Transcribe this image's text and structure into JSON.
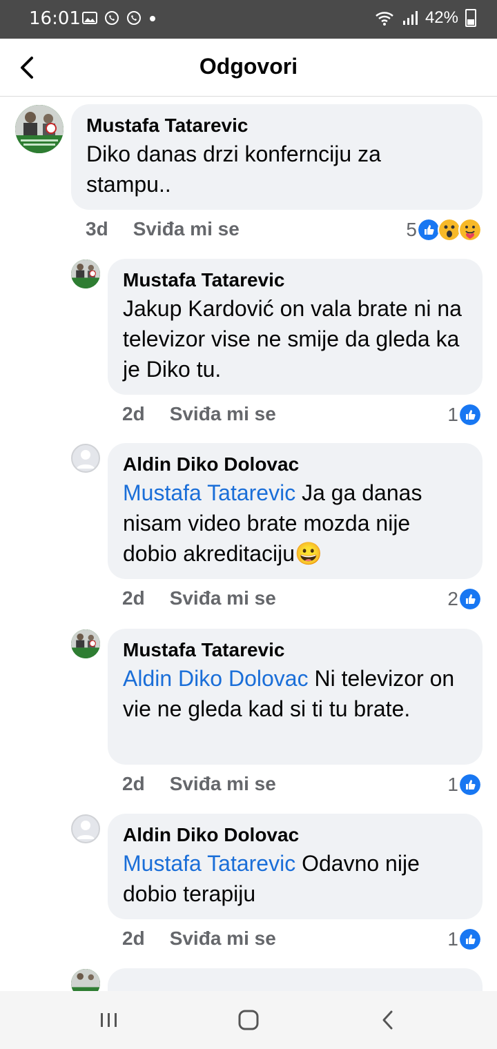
{
  "status": {
    "time": "16:01",
    "battery": "42%"
  },
  "header": {
    "title": "Odgovori"
  },
  "comments": [
    {
      "author": "Mustafa Tatarevic",
      "mention": "",
      "text": "Diko danas drzi konfernciju za stampu..",
      "time": "3d",
      "like_label": "Sviđa mi se",
      "reactions": "5",
      "reaction_types": [
        "like",
        "wow",
        "care"
      ]
    },
    {
      "author": "Mustafa Tatarevic",
      "mention": "",
      "text": "Jakup Kardović on vala brate ni na televizor vise ne smije da gleda ka je Diko tu.",
      "time": "2d",
      "like_label": "Sviđa mi se",
      "reactions": "1",
      "reaction_types": [
        "like"
      ]
    },
    {
      "author": "Aldin Diko Dolovac",
      "mention": "Mustafa Tatarevic",
      "text": " Ja ga danas nisam video brate mozda nije dobio akreditaciju😀",
      "time": "2d",
      "like_label": "Sviđa mi se",
      "reactions": "2",
      "reaction_types": [
        "like"
      ]
    },
    {
      "author": "Mustafa Tatarevic",
      "mention": "Aldin Diko Dolovac",
      "text": "  Ni televizor on vie ne gleda kad si ti tu brate.",
      "time": "2d",
      "like_label": "Sviđa mi se",
      "reactions": "1",
      "reaction_types": [
        "like"
      ]
    },
    {
      "author": "Aldin Diko Dolovac",
      "mention": "Mustafa Tatarevic",
      "text": " Odavno nije dobio terapiju",
      "time": "2d",
      "like_label": "Sviđa mi se",
      "reactions": "1",
      "reaction_types": [
        "like"
      ]
    }
  ],
  "colors": {
    "like": "#1877f2",
    "mention": "#1a6ed8",
    "bubble": "#f0f2f5",
    "meta": "#65676b"
  }
}
